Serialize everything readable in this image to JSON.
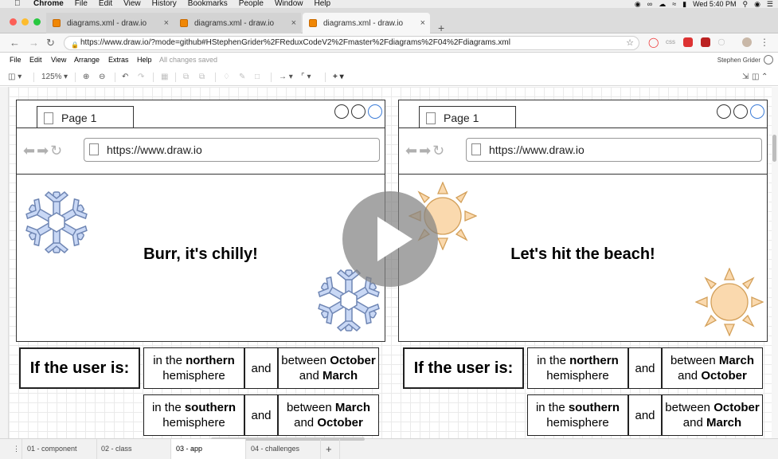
{
  "menubar": {
    "app": "Chrome",
    "items": [
      "File",
      "Edit",
      "View",
      "History",
      "Bookmarks",
      "People",
      "Window",
      "Help"
    ],
    "clock": "Wed 5:40 PM"
  },
  "tabs": [
    {
      "title": "diagrams.xml - draw.io",
      "active": false
    },
    {
      "title": "diagrams.xml - draw.io",
      "active": false
    },
    {
      "title": "diagrams.xml - draw.io",
      "active": true
    }
  ],
  "url": "https://www.draw.io/?mode=github#HStephenGrider%2FReduxCodeV2%2Fmaster%2Fdiagrams%2F04%2Fdiagrams.xml",
  "extensions": {
    "css": "css"
  },
  "drawio_menu": {
    "items": [
      "File",
      "Edit",
      "View",
      "Arrange",
      "Extras",
      "Help"
    ],
    "status": "All changes saved",
    "user": "Stephen Grider"
  },
  "toolbar": {
    "zoom": "125%"
  },
  "mockups": [
    {
      "tab_label": "Page 1",
      "address": "https://www.draw.io",
      "message": "Burr, it's chilly!",
      "table": {
        "head": "If the user is:",
        "rows": [
          {
            "hem_pre": "in the ",
            "hem_bold": "northern",
            "hem_post": "hemisphere",
            "and": "and",
            "range_pre": "between ",
            "range_b1": "October",
            "range_mid": "and ",
            "range_b2": "March"
          },
          {
            "hem_pre": "in the ",
            "hem_bold": "southern",
            "hem_post": "hemisphere",
            "and": "and",
            "range_pre": "between ",
            "range_b1": "March",
            "range_mid": "and ",
            "range_b2": "October"
          }
        ]
      }
    },
    {
      "tab_label": "Page 1",
      "address": "https://www.draw.io",
      "message": "Let's hit the beach!",
      "table": {
        "head": "If the user is:",
        "rows": [
          {
            "hem_pre": "in the ",
            "hem_bold": "northern",
            "hem_post": "hemisphere",
            "and": "and",
            "range_pre": "between ",
            "range_b1": "March",
            "range_mid": "and ",
            "range_b2": "October"
          },
          {
            "hem_pre": "in the ",
            "hem_bold": "southern",
            "hem_post": "hemisphere",
            "and": "and",
            "range_pre": "between ",
            "range_b1": "October",
            "range_mid": "and ",
            "range_b2": "March"
          }
        ]
      }
    }
  ],
  "page_tabs": [
    {
      "label": "01 - component",
      "active": false
    },
    {
      "label": "02 - class",
      "active": false
    },
    {
      "label": "03 - app",
      "active": true
    },
    {
      "label": "04 - challenges",
      "active": false
    }
  ],
  "colors": {
    "snowflake": "#c9d8f5",
    "sun_fill": "#fad9ae",
    "sun_stroke": "#d3a05a",
    "accent_blue": "#3d7dd8"
  }
}
